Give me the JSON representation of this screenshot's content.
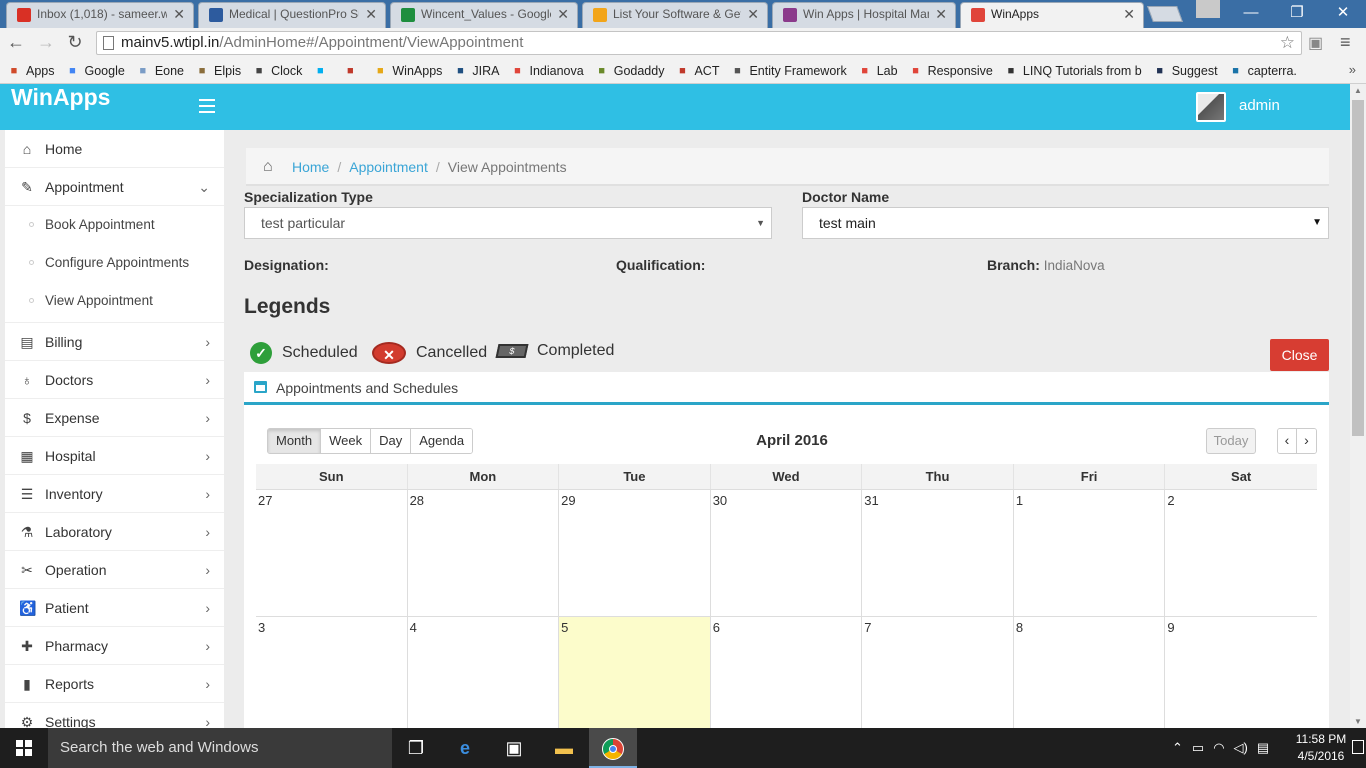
{
  "browser": {
    "tabs": [
      {
        "label": "Inbox (1,018) - sameer.w",
        "icon": "gmail-icon",
        "color": "#d93025"
      },
      {
        "label": "Medical | QuestionPro Su",
        "icon": "questionpro-icon",
        "color": "#2d5b9e"
      },
      {
        "label": "Wincent_Values - Google",
        "icon": "sheets-icon",
        "color": "#1e8e3e"
      },
      {
        "label": "List Your Software & Get",
        "icon": "chat-icon",
        "color": "#f2a51a"
      },
      {
        "label": "Win Apps | Hospital Man",
        "icon": "winapps-icon",
        "color": "#8b3a8b"
      },
      {
        "label": "WinApps",
        "icon": "winapps-cross-icon",
        "color": "#e0453a"
      }
    ],
    "url_host": "mainv5.wtipl.in",
    "url_path": "/AdminHome#/Appointment/ViewAppointment",
    "bookmarks": [
      {
        "label": "Apps",
        "icon": "apps-grid-icon",
        "color": "#d04a2a"
      },
      {
        "label": "Google",
        "icon": "google-icon",
        "color": "#4285f4"
      },
      {
        "label": "Eone",
        "icon": "cloud-icon",
        "color": "#7a9cc6"
      },
      {
        "label": "Elpis",
        "icon": "elpis-icon",
        "color": "#8a6d3b"
      },
      {
        "label": "Clock",
        "icon": "clock-icon",
        "color": "#444"
      },
      {
        "label": "",
        "icon": "skype-icon",
        "color": "#00aff0"
      },
      {
        "label": "",
        "icon": "fist-icon",
        "color": "#c0392b"
      },
      {
        "label": "WinApps",
        "icon": "mail-icon",
        "color": "#e6a817"
      },
      {
        "label": "JIRA",
        "icon": "jira-icon",
        "color": "#205081"
      },
      {
        "label": "Indianova",
        "icon": "cross-icon",
        "color": "#e0453a"
      },
      {
        "label": "Godaddy",
        "icon": "godaddy-icon",
        "color": "#6a8a2a"
      },
      {
        "label": "ACT",
        "icon": "act-icon",
        "color": "#c0392b"
      },
      {
        "label": "Entity Framework",
        "icon": "ef-icon",
        "color": "#555"
      },
      {
        "label": "Lab",
        "icon": "cross-icon",
        "color": "#e0453a"
      },
      {
        "label": "Responsive",
        "icon": "cross-icon",
        "color": "#e0453a"
      },
      {
        "label": "LINQ Tutorials from b",
        "icon": "mortarboard-icon",
        "color": "#333"
      },
      {
        "label": "Suggest",
        "icon": "s-icon",
        "color": "#223355"
      },
      {
        "label": "capterra.",
        "icon": "c-icon",
        "color": "#1a73a8"
      }
    ]
  },
  "app": {
    "brand": "WinApps",
    "user": "admin"
  },
  "sidebar": {
    "items": [
      {
        "label": "Home",
        "icon": "home-icon",
        "glyph": "⌂",
        "chevron": ""
      },
      {
        "label": "Appointment",
        "icon": "edit-icon",
        "glyph": "✎",
        "chevron": "⌄"
      },
      {
        "label": "Billing",
        "icon": "document-icon",
        "glyph": "▤",
        "chevron": "›"
      },
      {
        "label": "Doctors",
        "icon": "stethoscope-icon",
        "glyph": "♁",
        "chevron": "›"
      },
      {
        "label": "Expense",
        "icon": "dollar-icon",
        "glyph": "$",
        "chevron": "›"
      },
      {
        "label": "Hospital",
        "icon": "building-icon",
        "glyph": "▦",
        "chevron": "›"
      },
      {
        "label": "Inventory",
        "icon": "list-icon",
        "glyph": "☰",
        "chevron": "›"
      },
      {
        "label": "Laboratory",
        "icon": "flask-icon",
        "glyph": "⚗",
        "chevron": "›"
      },
      {
        "label": "Operation",
        "icon": "scissors-icon",
        "glyph": "✂",
        "chevron": "›"
      },
      {
        "label": "Patient",
        "icon": "wheelchair-icon",
        "glyph": "♿",
        "chevron": "›"
      },
      {
        "label": "Pharmacy",
        "icon": "plus-icon",
        "glyph": "✚",
        "chevron": "›"
      },
      {
        "label": "Reports",
        "icon": "book-icon",
        "glyph": "▮",
        "chevron": "›"
      },
      {
        "label": "Settings",
        "icon": "gear-icon",
        "glyph": "⚙",
        "chevron": "›"
      }
    ],
    "submenu": [
      "Book Appointment",
      "Configure Appointments",
      "View Appointment"
    ]
  },
  "breadcrumb": {
    "home": "Home",
    "section": "Appointment",
    "current": "View Appointments",
    "separator": "/"
  },
  "filters": {
    "specialization_label": "Specialization Type",
    "specialization_value": "test particular",
    "doctor_label": "Doctor Name",
    "doctor_value": "test main"
  },
  "info": {
    "designation_label": "Designation:",
    "designation_value": "",
    "qualification_label": "Qualification:",
    "qualification_value": "",
    "branch_label": "Branch:",
    "branch_value": "IndiaNova"
  },
  "legends": {
    "title": "Legends",
    "scheduled": "Scheduled",
    "cancelled": "Cancelled",
    "completed": "Completed",
    "close": "Close"
  },
  "calendar": {
    "panel_title": "Appointments and Schedules",
    "views": [
      "Month",
      "Week",
      "Day",
      "Agenda"
    ],
    "active_view": "Month",
    "title": "April 2016",
    "today": "Today",
    "prev": "‹",
    "next": "›",
    "weekdays": [
      "Sun",
      "Mon",
      "Tue",
      "Wed",
      "Thu",
      "Fri",
      "Sat"
    ],
    "weeks": [
      [
        "27",
        "28",
        "29",
        "30",
        "31",
        "1",
        "2"
      ],
      [
        "3",
        "4",
        "5",
        "6",
        "7",
        "8",
        "9"
      ]
    ],
    "today_cell": "5",
    "today_color": "#fcfccb"
  },
  "taskbar": {
    "search_placeholder": "Search the web and Windows",
    "time": "11:58 PM",
    "date": "4/5/2016"
  },
  "colors": {
    "header": "#2fbfe4",
    "accent": "#2aa5c8",
    "close_button": "#d73d32",
    "link": "#3aa5d6"
  }
}
